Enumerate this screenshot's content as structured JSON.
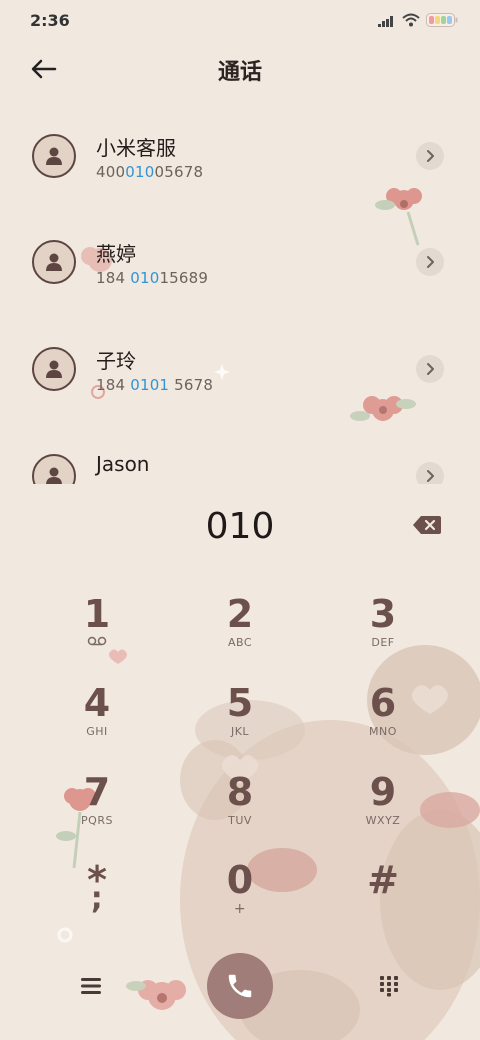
{
  "status_bar": {
    "time": "2:36",
    "icons": [
      "signal-icon",
      "wifi-icon",
      "battery-icon"
    ]
  },
  "header": {
    "title": "通话",
    "back_icon": "back-arrow-icon"
  },
  "contacts": [
    {
      "name": "小米客服",
      "number_parts": [
        "400",
        "010",
        "05678"
      ]
    },
    {
      "name": "燕婷",
      "number_parts": [
        "184 ",
        "010",
        "15689"
      ]
    },
    {
      "name": "子玲",
      "number_parts": [
        "184 ",
        "0101",
        " 5678"
      ]
    },
    {
      "name": "Jason",
      "number_parts": [
        "",
        "",
        ""
      ]
    }
  ],
  "dialer": {
    "value": "010",
    "backspace_icon": "backspace-icon"
  },
  "keypad": [
    {
      "digit": "1",
      "letters": "",
      "sub_icon": "voicemail-icon"
    },
    {
      "digit": "2",
      "letters": "ABC"
    },
    {
      "digit": "3",
      "letters": "DEF"
    },
    {
      "digit": "4",
      "letters": "GHI"
    },
    {
      "digit": "5",
      "letters": "JKL"
    },
    {
      "digit": "6",
      "letters": "MNO"
    },
    {
      "digit": "7",
      "letters": "PQRS"
    },
    {
      "digit": "8",
      "letters": "TUV"
    },
    {
      "digit": "9",
      "letters": "WXYZ"
    },
    {
      "digit": "*",
      "letters": ";"
    },
    {
      "digit": "0",
      "letters": "+"
    },
    {
      "digit": "#",
      "letters": ""
    }
  ],
  "bottom_bar": {
    "menu_icon": "menu-icon",
    "call_icon": "phone-icon",
    "keypad_icon": "keypad-grid-icon"
  },
  "colors": {
    "background": "#f1e9df",
    "accent_number": "#2f95d6",
    "key_digit": "#6c504c",
    "call_button": "#a07d78"
  }
}
